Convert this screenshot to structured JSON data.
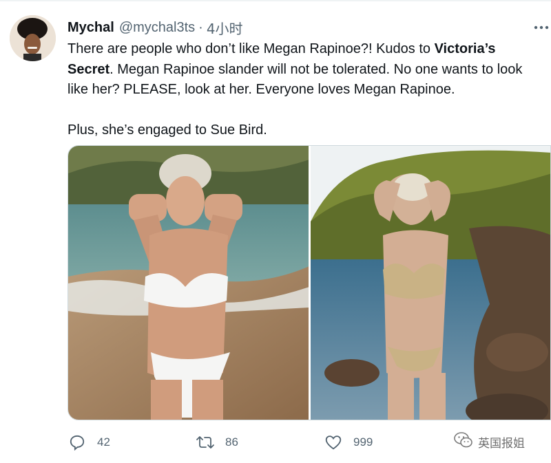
{
  "tweet": {
    "author": {
      "display_name": "Mychal",
      "handle": "@mychal3ts",
      "avatar_icon": "avatar-photo"
    },
    "separator": "·",
    "timestamp": "4小时",
    "text": {
      "line1_prefix": "There are people who don’t like Megan Rapinoe?! Kudos to ",
      "line1_bold": "Victoria’s Secret",
      "line1_suffix": ". Megan Rapinoe slander will not be tolerated. No one wants to look like her? PLEASE, look at her. Everyone loves Megan Rapinoe.",
      "line2": "Plus, she’s engaged to Sue Bird."
    },
    "media": [
      {
        "alt_icon": "photo-beach-white-bikini"
      },
      {
        "alt_icon": "photo-rocks-gold-bikini"
      }
    ],
    "actions": {
      "reply_count": "42",
      "retweet_count": "86",
      "like_count": "999"
    }
  },
  "watermark": {
    "text": "英国报姐",
    "icon": "wechat-icon"
  },
  "colors": {
    "text_primary": "#0f1419",
    "text_secondary": "#536471",
    "divider": "#eff3f4"
  }
}
